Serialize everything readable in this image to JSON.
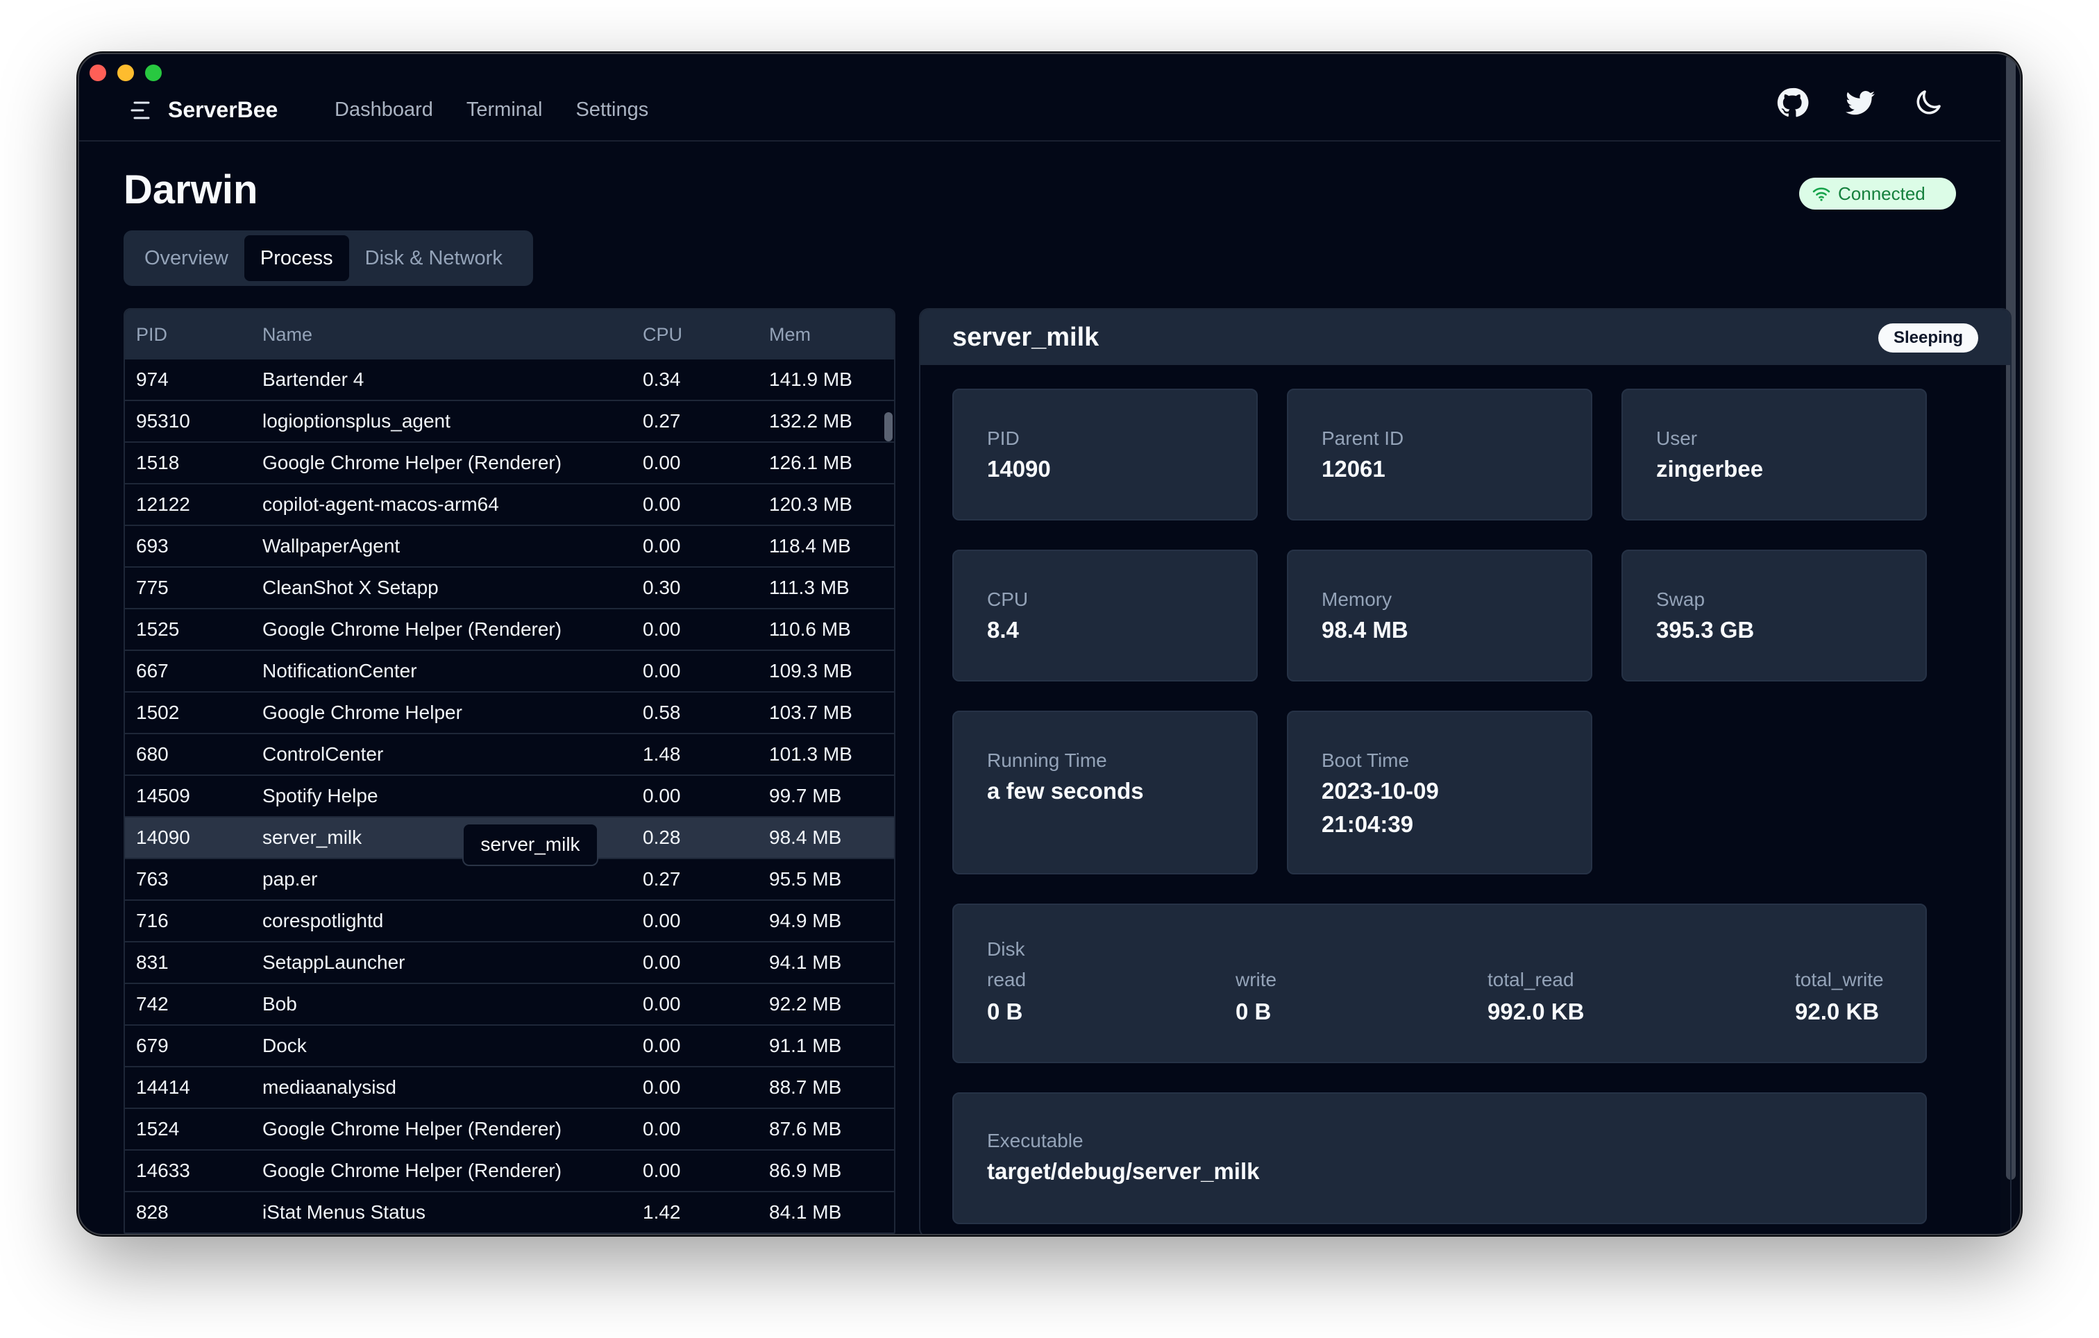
{
  "app": {
    "brand": "ServerBee",
    "nav": [
      "Dashboard",
      "Terminal",
      "Settings"
    ]
  },
  "page": {
    "title": "Darwin",
    "connection_status": "Connected",
    "tabs": [
      "Overview",
      "Process",
      "Disk & Network"
    ],
    "active_tab": "Process"
  },
  "table": {
    "headers": [
      "PID",
      "Name",
      "CPU",
      "Mem"
    ],
    "rows": [
      {
        "pid": "974",
        "name": "Bartender 4",
        "cpu": "0.34",
        "mem": "141.9 MB"
      },
      {
        "pid": "95310",
        "name": "logioptionsplus_agent",
        "cpu": "0.27",
        "mem": "132.2 MB"
      },
      {
        "pid": "1518",
        "name": "Google Chrome Helper (Renderer)",
        "cpu": "0.00",
        "mem": "126.1 MB"
      },
      {
        "pid": "12122",
        "name": "copilot-agent-macos-arm64",
        "cpu": "0.00",
        "mem": "120.3 MB"
      },
      {
        "pid": "693",
        "name": "WallpaperAgent",
        "cpu": "0.00",
        "mem": "118.4 MB"
      },
      {
        "pid": "775",
        "name": "CleanShot X Setapp",
        "cpu": "0.30",
        "mem": "111.3 MB"
      },
      {
        "pid": "1525",
        "name": "Google Chrome Helper (Renderer)",
        "cpu": "0.00",
        "mem": "110.6 MB"
      },
      {
        "pid": "667",
        "name": "NotificationCenter",
        "cpu": "0.00",
        "mem": "109.3 MB"
      },
      {
        "pid": "1502",
        "name": "Google Chrome Helper",
        "cpu": "0.58",
        "mem": "103.7 MB"
      },
      {
        "pid": "680",
        "name": "ControlCenter",
        "cpu": "1.48",
        "mem": "101.3 MB"
      },
      {
        "pid": "14509",
        "name": "Spotify Helpe",
        "cpu": "0.00",
        "mem": "99.7 MB"
      },
      {
        "pid": "14090",
        "name": "server_milk",
        "cpu": "0.28",
        "mem": "98.4 MB"
      },
      {
        "pid": "763",
        "name": "pap.er",
        "cpu": "0.27",
        "mem": "95.5 MB"
      },
      {
        "pid": "716",
        "name": "corespotlightd",
        "cpu": "0.00",
        "mem": "94.9 MB"
      },
      {
        "pid": "831",
        "name": "SetappLauncher",
        "cpu": "0.00",
        "mem": "94.1 MB"
      },
      {
        "pid": "742",
        "name": "Bob",
        "cpu": "0.00",
        "mem": "92.2 MB"
      },
      {
        "pid": "679",
        "name": "Dock",
        "cpu": "0.00",
        "mem": "91.1 MB"
      },
      {
        "pid": "14414",
        "name": "mediaanalysisd",
        "cpu": "0.00",
        "mem": "88.7 MB"
      },
      {
        "pid": "1524",
        "name": "Google Chrome Helper (Renderer)",
        "cpu": "0.00",
        "mem": "87.6 MB"
      },
      {
        "pid": "14633",
        "name": "Google Chrome Helper (Renderer)",
        "cpu": "0.00",
        "mem": "86.9 MB"
      },
      {
        "pid": "828",
        "name": "iStat Menus Status",
        "cpu": "1.42",
        "mem": "84.1 MB"
      }
    ],
    "selected_pid": "14090",
    "tooltip": "server_milk"
  },
  "detail": {
    "title": "server_milk",
    "status": "Sleeping",
    "pid": {
      "label": "PID",
      "value": "14090"
    },
    "parent_id": {
      "label": "Parent ID",
      "value": "12061"
    },
    "user": {
      "label": "User",
      "value": "zingerbee"
    },
    "cpu": {
      "label": "CPU",
      "value": "8.4"
    },
    "memory": {
      "label": "Memory",
      "value": "98.4 MB"
    },
    "swap": {
      "label": "Swap",
      "value": "395.3 GB"
    },
    "running_time": {
      "label": "Running Time",
      "value": "a few seconds"
    },
    "boot_time": {
      "label": "Boot Time",
      "date": "2023-10-09",
      "time": "21:04:39"
    },
    "disk": {
      "title": "Disk",
      "read": {
        "label": "read",
        "value": "0 B"
      },
      "write": {
        "label": "write",
        "value": "0 B"
      },
      "total_read": {
        "label": "total_read",
        "value": "992.0 KB"
      },
      "total_write": {
        "label": "total_write",
        "value": "92.0 KB"
      }
    },
    "executable": {
      "label": "Executable",
      "value": "target/debug/server_milk"
    }
  },
  "icons": {
    "menu": "menu-icon",
    "github": "github-icon",
    "twitter": "twitter-icon",
    "theme": "moon-icon",
    "wifi": "wifi-icon"
  },
  "colors": {
    "background": "#030817",
    "surface": "#1e293b",
    "connected_bg": "#dcfce7",
    "connected_text": "#15803d"
  }
}
